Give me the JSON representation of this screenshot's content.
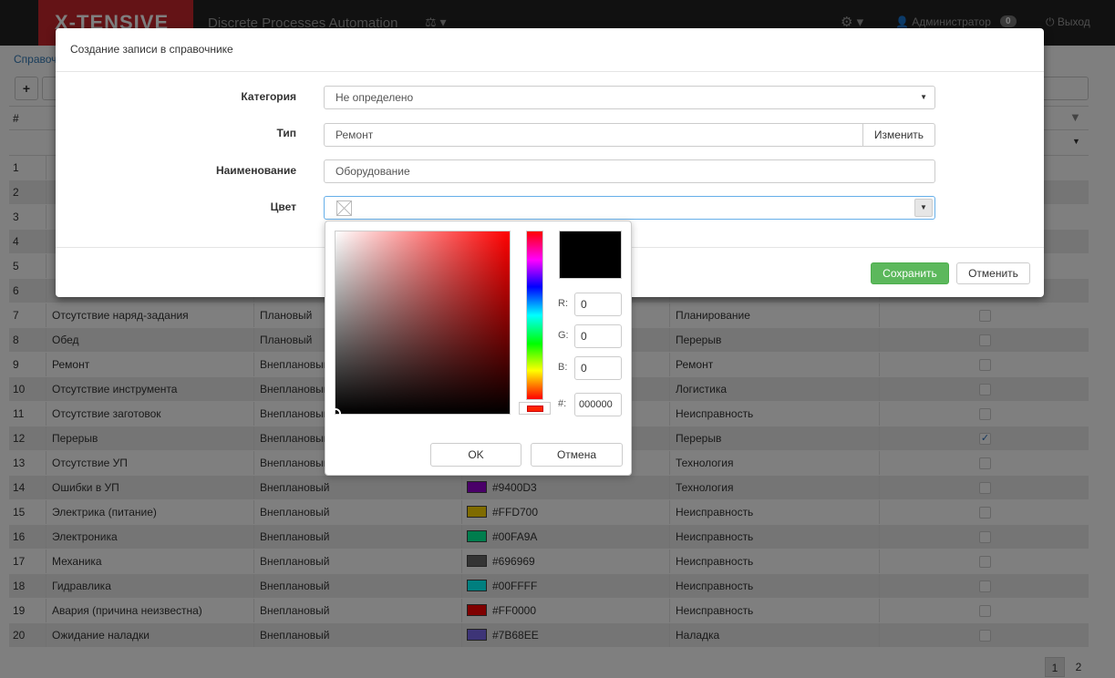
{
  "navbar": {
    "brand": "X-TENSIVE",
    "app_title": "Discrete Processes Automation",
    "cubes_icon": "cubes-icon",
    "settings_icon": "gear-icon",
    "user": "Администратор",
    "notification_count": "0",
    "logout": "Выход"
  },
  "page": {
    "breadcrumb": "Справоч",
    "add_label": "+",
    "grid_num_header": "#",
    "rows": [
      {
        "num": "1",
        "name": "",
        "type": "",
        "color": "",
        "category": "",
        "checked": false
      },
      {
        "num": "2",
        "name": "",
        "type": "",
        "color": "",
        "category": "",
        "checked": false
      },
      {
        "num": "3",
        "name": "",
        "type": "",
        "color": "",
        "category": "",
        "checked": false
      },
      {
        "num": "4",
        "name": "",
        "type": "",
        "color": "",
        "category": "",
        "checked": false
      },
      {
        "num": "5",
        "name": "",
        "type": "",
        "color": "",
        "category": "",
        "checked": false
      },
      {
        "num": "6",
        "name": "",
        "type": "",
        "color": "",
        "category": "",
        "checked": false
      },
      {
        "num": "7",
        "name": "Отсутствие наряд-задания",
        "type": "Плановый",
        "color": "",
        "category": "Планирование",
        "checked": false
      },
      {
        "num": "8",
        "name": "Обед",
        "type": "Плановый",
        "color": "",
        "category": "Перерыв",
        "checked": false
      },
      {
        "num": "9",
        "name": "Ремонт",
        "type": "Внеплановый",
        "color": "",
        "category": "Ремонт",
        "checked": false
      },
      {
        "num": "10",
        "name": "Отсутствие инструмента",
        "type": "Внеплановый",
        "color": "",
        "category": "Логистика",
        "checked": false
      },
      {
        "num": "11",
        "name": "Отсутствие заготовок",
        "type": "Внеплановый",
        "color": "",
        "category": "Неисправность",
        "checked": false
      },
      {
        "num": "12",
        "name": "Перерыв",
        "type": "Внеплановый",
        "color": "",
        "category": "Перерыв",
        "checked": true
      },
      {
        "num": "13",
        "name": "Отсутствие УП",
        "type": "Внеплановый",
        "color": "",
        "category": "Технология",
        "checked": false
      },
      {
        "num": "14",
        "name": "Ошибки в УП",
        "type": "Внеплановый",
        "color": "#9400D3",
        "category": "Технология",
        "checked": false
      },
      {
        "num": "15",
        "name": "Электрика (питание)",
        "type": "Внеплановый",
        "color": "#FFD700",
        "category": "Неисправность",
        "checked": false
      },
      {
        "num": "16",
        "name": "Электроника",
        "type": "Внеплановый",
        "color": "#00FA9A",
        "category": "Неисправность",
        "checked": false
      },
      {
        "num": "17",
        "name": "Механика",
        "type": "Внеплановый",
        "color": "#696969",
        "category": "Неисправность",
        "checked": false
      },
      {
        "num": "18",
        "name": "Гидравлика",
        "type": "Внеплановый",
        "color": "#00FFFF",
        "category": "Неисправность",
        "checked": false
      },
      {
        "num": "19",
        "name": "Авария (причина неизвестна)",
        "type": "Внеплановый",
        "color": "#FF0000",
        "category": "Неисправность",
        "checked": false
      },
      {
        "num": "20",
        "name": "Ожидание наладки",
        "type": "Внеплановый",
        "color": "#7B68EE",
        "category": "Наладка",
        "checked": false
      }
    ],
    "pages": [
      "1",
      "2"
    ],
    "active_page": "1"
  },
  "modal": {
    "title": "Создание записи в справочнике",
    "category_label": "Категория",
    "category_value": "Не определено",
    "type_label": "Тип",
    "type_value": "Ремонт",
    "change_button": "Изменить",
    "name_label": "Наименование",
    "name_value": "Оборудование",
    "color_label": "Цвет",
    "save_button": "Сохранить",
    "cancel_button": "Отменить"
  },
  "picker": {
    "r_label": "R:",
    "r_value": "0",
    "g_label": "G:",
    "g_value": "0",
    "b_label": "B:",
    "b_value": "0",
    "hex_label": "#:",
    "hex_value": "000000",
    "preview_color": "#000000",
    "hue_color": "#ff0000",
    "ok_button": "OK",
    "cancel_button": "Отмена"
  }
}
